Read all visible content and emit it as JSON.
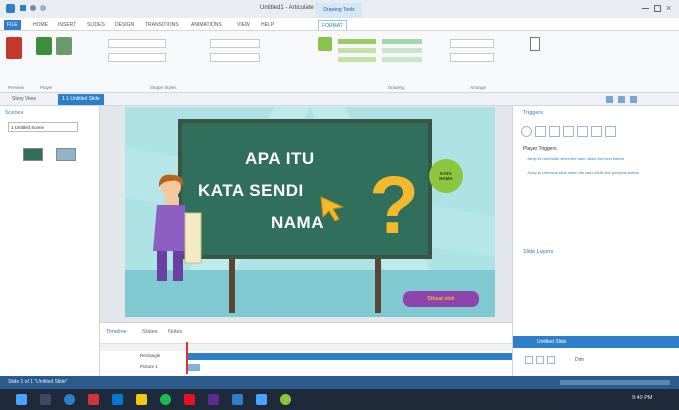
{
  "window": {
    "title": "Untitled1 - Articulate Storyline",
    "context_tab": "Drawing Tools"
  },
  "ribbon_tabs": [
    "FILE",
    "HOME",
    "INSERT",
    "SLIDES",
    "DESIGN",
    "TRANSITIONS",
    "ANIMATIONS",
    "VIEW",
    "HELP",
    "FORMAT"
  ],
  "ribbon": {
    "groups": {
      "preview": "Preview",
      "player": "Player",
      "shape_styles": "Shape Styles",
      "drawing": "Drawing",
      "arrange": "Arrange"
    }
  },
  "doc_tabs": {
    "story": "Story View",
    "slide": "1.1 Untitled Slide"
  },
  "left_panel": {
    "title": "Scenes",
    "dropdown": "1 Untitled Scene"
  },
  "slide": {
    "line1": "APA ITU",
    "line2": "KATA SENDI",
    "line3": "NAMA",
    "badge": "KATA NAMA",
    "brand": "Dibuat oleh"
  },
  "right_panel": {
    "title": "Triggers",
    "slide_triggers": "Player Triggers",
    "trigger1": "Jump to next slide when the user clicks the next button",
    "trigger2": "Jump to previous slide when the user clicks the previous button",
    "layers_title": "Slide Layers",
    "base_layer": "Untitled Slide",
    "dim": "Dim"
  },
  "timeline": {
    "tabs": [
      "Timeline",
      "States",
      "Notes"
    ],
    "row1": "Rectangle",
    "row2": "Picture 1"
  },
  "status": {
    "text": "Slide 1 of 1 \"Untitled Slide\"",
    "clock": "9:40 PM"
  },
  "colors": {
    "ribbon_blue": "#2d7fc9",
    "board": "#2f6f5b",
    "slide_bg": "#aee3e6",
    "question": "#f2b92f",
    "badge": "#8cc63f"
  }
}
